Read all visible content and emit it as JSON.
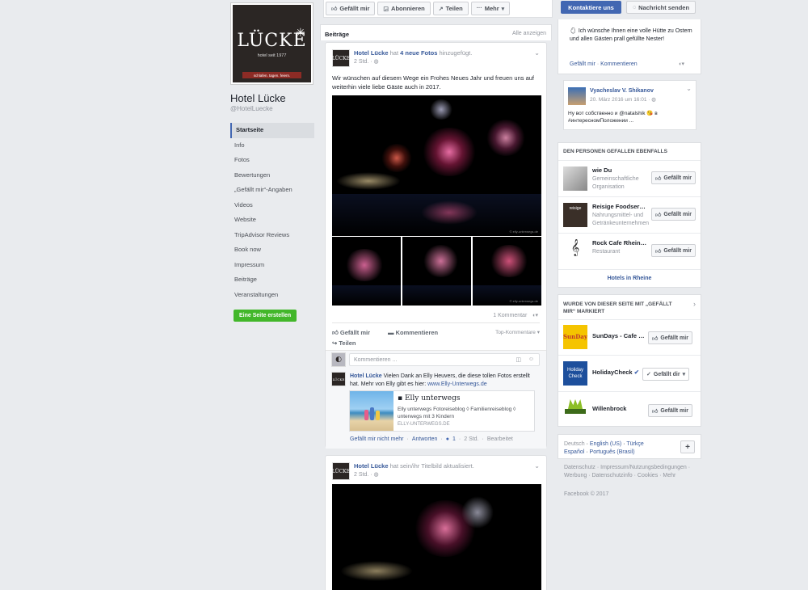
{
  "profile": {
    "logo_word": "LÜCKE",
    "logo_sub": "hotel seit 1977",
    "logo_tag": "schlafen. tagen. feiern.",
    "name": "Hotel Lücke",
    "handle": "@HotelLuecke"
  },
  "nav": {
    "items": [
      "Startseite",
      "Info",
      "Fotos",
      "Bewertungen",
      "„Gefällt mir“-Angaben",
      "Videos",
      "Website",
      "TripAdvisor Reviews",
      "Book now",
      "Impressum",
      "Beiträge",
      "Veranstaltungen"
    ],
    "active_index": 0,
    "create_page": "Eine Seite erstellen"
  },
  "toolbar": {
    "like": "Gefällt mir",
    "follow": "Abonnieren",
    "share": "Teilen",
    "more": "Mehr",
    "contact": "Kontaktiere uns",
    "message": "Nachricht senden"
  },
  "feed": {
    "section_title": "Beiträge",
    "show_all": "Alle anzeigen",
    "post1": {
      "author": "Hotel Lücke",
      "action_pre": " hat ",
      "action_link": "4 neue Fotos",
      "action_post": " hinzugefügt.",
      "time": "2 Std. · ",
      "text": "Wir wünschen auf diesem Wege ein Frohes Neues Jahr und freuen uns auf weiterhin viele liebe Gäste auch in 2017.",
      "photo_credit": "© elly-unterwegs.de",
      "comments_count": "1 Kommentar",
      "like": "Gefällt mir",
      "comment": "Kommentieren",
      "share": "Teilen",
      "top_comments": "Top-Kommentare",
      "comment_placeholder": "Kommentieren ...",
      "reply": {
        "author": "Hotel Lücke",
        "text_pre": " Vielen Dank an Elly Heuvers, die diese tollen Fotos erstellt hat. Mehr von Elly gibt es hier: ",
        "link": "www.Elly-Unterwegs.de",
        "preview_title": "▪ Elly unterwegs",
        "preview_desc": "Elly unterwegs Fotoreiseblog ◊ Familienreiseblog ◊ unterwegs mit 3 Kindern",
        "preview_domain": "ELLY-UNTERWEGS.DE",
        "unlike": "Gefällt mir nicht mehr",
        "answer": "Antworten",
        "likes": "1",
        "time": "2 Std.",
        "edited": "Bearbeitet"
      }
    },
    "post2": {
      "author": "Hotel Lücke",
      "action": " hat sein/ihr Titelbild aktualisiert.",
      "time": "2 Std. · "
    }
  },
  "right": {
    "top_post": {
      "text": "Ich wünsche Ihnen eine volle Hütte zu Ostern und allen Gästen prall gefüllte Nester!",
      "like": "Gefällt mir",
      "comment": "Kommentieren"
    },
    "review": {
      "name": "Vyacheslav V. Shikanov",
      "date": "20. März 2016 um 16:01",
      "text": "Ну вот собственно и @natalshik 😘 в #интересномПоложении ..."
    },
    "similar": {
      "title": "DEN PERSONEN GEFALLEN EBENFALLS",
      "items": [
        {
          "name": "wie Du",
          "category": "Gemeinschaftliche Organisation"
        },
        {
          "name": "Reisige Foodser…",
          "category": "Nahrungsmittel- und Getränkeunternehmen"
        },
        {
          "name": "Rock Cafe Rhein…",
          "category": "Restaurant"
        }
      ],
      "like_label": "Gefällt mir",
      "footer_link": "Hotels in Rheine"
    },
    "liked_by_page": {
      "title": "WURDE VON DIESER SEITE MIT „GEFÄLLT MIR“ MARKIERT",
      "items": [
        {
          "name": "SunDays - Cafe …",
          "button": "Gefällt mir"
        },
        {
          "name": "HolidayCheck",
          "button": "Gefällt dir"
        },
        {
          "name": "Willenbrock",
          "button": "Gefällt mir"
        }
      ]
    },
    "languages": {
      "current": "Deutsch",
      "options": [
        "English (US)",
        "Türkçe",
        "Español",
        "Português (Brasil)"
      ],
      "plus": "+"
    },
    "footer": {
      "links": "Datenschutz · Impressum/Nutzungsbedingungen · Werbung · Datenschutzinfo · Cookies · Mehr",
      "copyright": "Facebook © 2017"
    }
  },
  "colors": {
    "brand_blue": "#4267b2",
    "link": "#365899",
    "green": "#42b72a",
    "background": "#e9ebee"
  }
}
